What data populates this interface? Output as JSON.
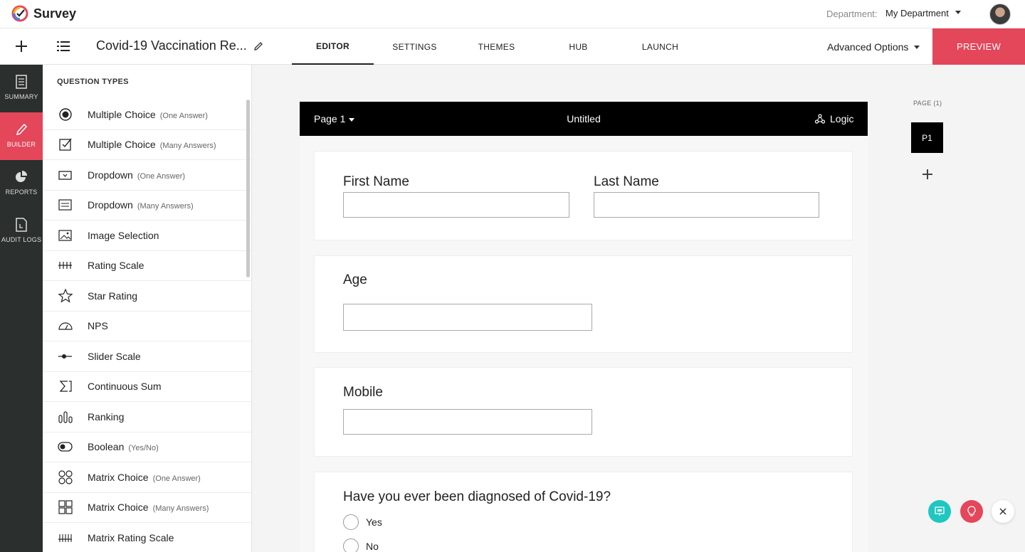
{
  "app": {
    "name": "Survey"
  },
  "topbar": {
    "department_label": "Department:",
    "department_value": "My Department"
  },
  "navbar": {
    "survey_title": "Covid-19 Vaccination Re...",
    "tabs": [
      {
        "label": "EDITOR",
        "active": true
      },
      {
        "label": "SETTINGS"
      },
      {
        "label": "THEMES"
      },
      {
        "label": "HUB"
      },
      {
        "label": "LAUNCH"
      }
    ],
    "advanced_options": "Advanced Options",
    "preview": "PREVIEW"
  },
  "rail": {
    "items": [
      {
        "label": "SUMMARY",
        "icon": "document-icon"
      },
      {
        "label": "BUILDER",
        "icon": "pencil-icon",
        "active": true
      },
      {
        "label": "REPORTS",
        "icon": "pie-chart-icon"
      },
      {
        "label": "AUDIT LOGS",
        "icon": "log-file-icon"
      }
    ]
  },
  "question_types": {
    "title": "QUESTION TYPES",
    "items": [
      {
        "name": "Multiple Choice",
        "note": "(One Answer)",
        "icon": "radio-icon"
      },
      {
        "name": "Multiple Choice",
        "note": "(Many Answers)",
        "icon": "checkbox-icon"
      },
      {
        "name": "Dropdown",
        "note": "(One Answer)",
        "icon": "dropdown-icon"
      },
      {
        "name": "Dropdown",
        "note": "(Many Answers)",
        "icon": "multi-dropdown-icon"
      },
      {
        "name": "Image Selection",
        "note": "",
        "icon": "image-icon"
      },
      {
        "name": "Rating Scale",
        "note": "",
        "icon": "rating-scale-icon"
      },
      {
        "name": "Star Rating",
        "note": "",
        "icon": "star-icon"
      },
      {
        "name": "NPS",
        "note": "",
        "icon": "gauge-icon"
      },
      {
        "name": "Slider Scale",
        "note": "",
        "icon": "slider-icon"
      },
      {
        "name": "Continuous Sum",
        "note": "",
        "icon": "sigma-icon"
      },
      {
        "name": "Ranking",
        "note": "",
        "icon": "ranking-icon"
      },
      {
        "name": "Boolean",
        "note": "(Yes/No)",
        "icon": "toggle-icon"
      },
      {
        "name": "Matrix Choice",
        "note": "(One Answer)",
        "icon": "matrix-radio-icon"
      },
      {
        "name": "Matrix Choice",
        "note": "(Many Answers)",
        "icon": "matrix-checkbox-icon"
      },
      {
        "name": "Matrix Rating Scale",
        "note": "",
        "icon": "matrix-rating-icon"
      }
    ]
  },
  "page": {
    "page_selector": "Page 1",
    "title": "Untitled",
    "logic": "Logic",
    "fields": {
      "first_name": "First Name",
      "last_name": "Last Name",
      "age": "Age",
      "mobile": "Mobile",
      "covid_question": "Have you ever been diagnosed of Covid-19?",
      "options": [
        "Yes",
        "No"
      ]
    }
  },
  "pages_panel": {
    "label": "PAGE (1)",
    "pages": [
      "P1"
    ]
  },
  "colors": {
    "accent": "#e4465a",
    "teal": "#1fc7c0",
    "rail": "#2b2f2e"
  }
}
